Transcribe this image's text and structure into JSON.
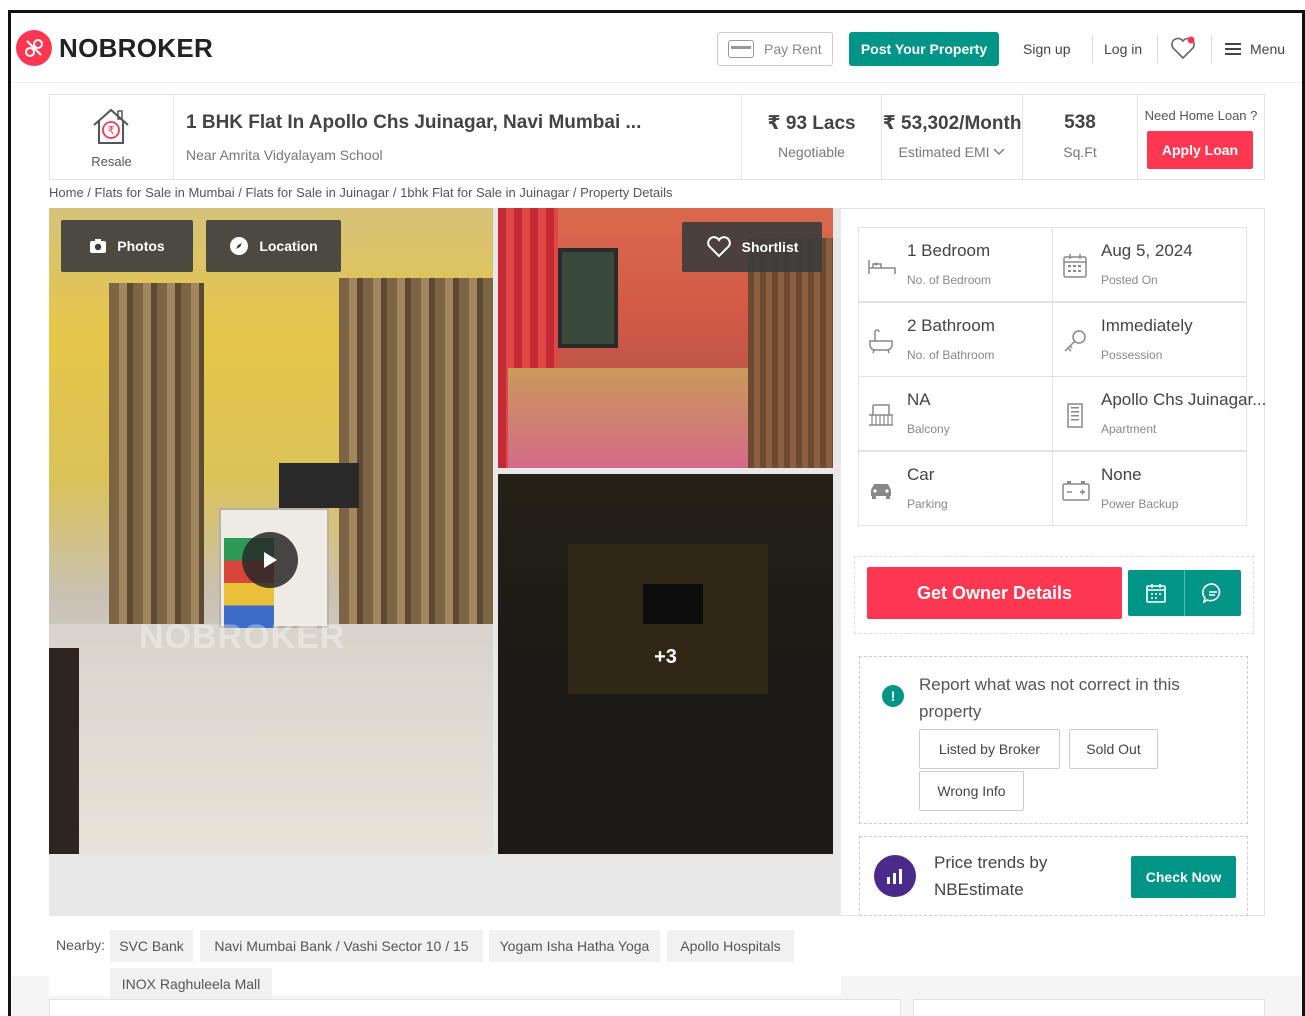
{
  "header": {
    "logo_text": "NOBROKER",
    "pay_rent": "Pay Rent",
    "post_property": "Post Your Property",
    "sign_up": "Sign up",
    "log_in": "Log in",
    "menu": "Menu"
  },
  "title_bar": {
    "resale_label": "Resale",
    "title": "1 BHK Flat In Apollo Chs Juinagar, Navi Mumbai ...",
    "subtitle": "Near Amrita Vidyalayam School",
    "price": "₹ 93 Lacs",
    "price_note": "Negotiable",
    "emi": "₹ 53,302/Month",
    "emi_note": "Estimated EMI",
    "area": "538",
    "area_unit": "Sq.Ft",
    "loan_question": "Need Home Loan ?",
    "apply_loan": "Apply Loan"
  },
  "breadcrumb": "Home / Flats for Sale in Mumbai / Flats for Sale in Juinagar / 1bhk Flat for Sale in Juinagar / Property Details",
  "gallery": {
    "photos_btn": "Photos",
    "location_btn": "Location",
    "shortlist_btn": "Shortlist",
    "more_count": "+3",
    "watermark": "NOBROKER"
  },
  "details": [
    {
      "value": "1 Bedroom",
      "label": "No. of Bedroom",
      "icon": "bed-icon"
    },
    {
      "value": "Aug 5, 2024",
      "label": "Posted On",
      "icon": "calendar-icon"
    },
    {
      "value": "2 Bathroom",
      "label": "No. of Bathroom",
      "icon": "bathtub-icon"
    },
    {
      "value": "Immediately",
      "label": "Possession",
      "icon": "key-icon"
    },
    {
      "value": "NA",
      "label": "Balcony",
      "icon": "balcony-icon"
    },
    {
      "value": "Apollo Chs Juinagar...",
      "label": "Apartment",
      "icon": "building-icon"
    },
    {
      "value": "Car",
      "label": "Parking",
      "icon": "car-icon"
    },
    {
      "value": "None",
      "label": "Power Backup",
      "icon": "battery-icon"
    }
  ],
  "owner": {
    "get_owner_details": "Get Owner Details"
  },
  "report": {
    "text": "Report what was not correct in this property",
    "options": [
      "Listed by Broker",
      "Sold Out",
      "Wrong Info"
    ]
  },
  "price_trends": {
    "text_line1": "Price trends by",
    "text_line2": "NBEstimate",
    "button": "Check Now"
  },
  "nearby": {
    "label": "Nearby:",
    "places": [
      "SVC Bank",
      "Navi Mumbai Bank / Vashi Sector 10 / 15",
      "Yogam Isha Hatha Yoga",
      "Apollo Hospitals",
      "INOX Raghuleela Mall"
    ]
  },
  "colors": {
    "brand_red": "#fd3752",
    "brand_teal": "#009587",
    "estimate_purple": "#4a2b8c"
  }
}
